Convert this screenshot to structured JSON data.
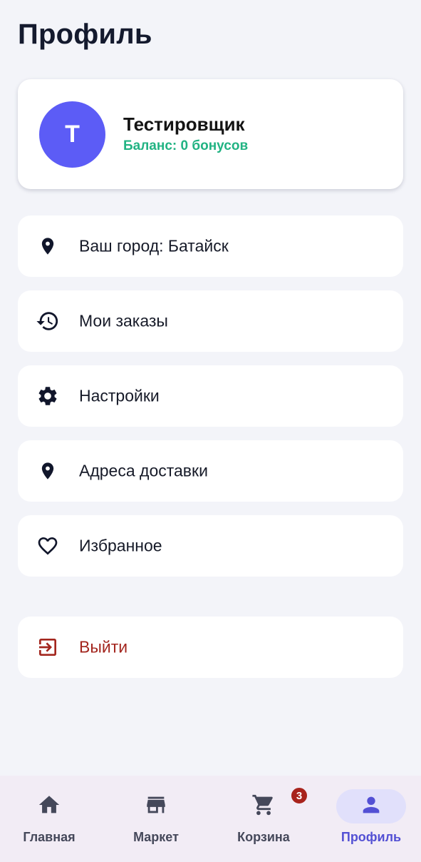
{
  "header": {
    "title": "Профиль"
  },
  "profile": {
    "avatar_letter": "Т",
    "name": "Тестировщик",
    "balance": "Баланс: 0 бонусов",
    "avatar_color": "#5c5cf6",
    "balance_color": "#22b383"
  },
  "menu": {
    "items": [
      {
        "label": "Ваш город: Батайск",
        "icon": "location-pin-icon"
      },
      {
        "label": "Мои заказы",
        "icon": "history-icon"
      },
      {
        "label": "Настройки",
        "icon": "gear-icon"
      },
      {
        "label": "Адреса доставки",
        "icon": "location-pin-icon"
      },
      {
        "label": "Избранное",
        "icon": "heart-icon"
      }
    ],
    "logout": {
      "label": "Выйти",
      "icon": "logout-icon",
      "color": "#a3261e"
    }
  },
  "bottom_nav": {
    "items": [
      {
        "label": "Главная",
        "icon": "home-icon"
      },
      {
        "label": "Маркет",
        "icon": "store-icon"
      },
      {
        "label": "Корзина",
        "icon": "cart-icon",
        "badge": "3"
      },
      {
        "label": "Профиль",
        "icon": "person-icon",
        "active": true
      }
    ],
    "active_color": "#5350d4"
  }
}
